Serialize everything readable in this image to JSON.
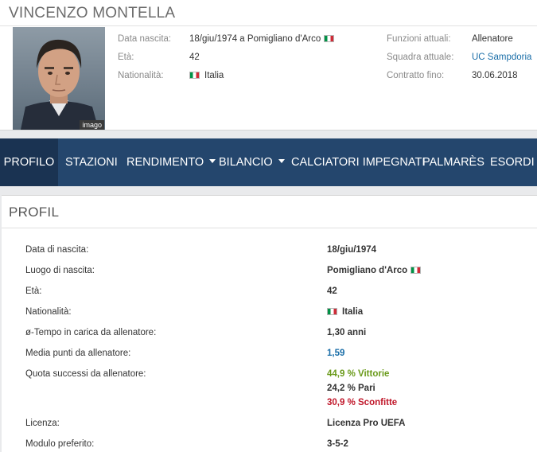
{
  "header": {
    "name": "VINCENZO MONTELLA",
    "photo_credit": "imago",
    "left_col": [
      {
        "label": "Data nascita:",
        "value": "18/giu/1974 a Pomigliano d'Arco",
        "flag": "italy-flag"
      },
      {
        "label": "Età:",
        "value": "42"
      },
      {
        "label": "Nationalità:",
        "value": "Italia",
        "flag": "italy-flag"
      }
    ],
    "right_col": [
      {
        "label": "Funzioni attuali:",
        "value": "Allenatore"
      },
      {
        "label": "Squadra attuale:",
        "value": "UC Sampdoria",
        "link": true
      },
      {
        "label": "Contratto fino:",
        "value": "30.06.2018"
      }
    ]
  },
  "nav": {
    "items": [
      {
        "label": "Profilo",
        "active": true
      },
      {
        "label": "Stazioni"
      },
      {
        "label": "Rendimento",
        "dropdown": true
      },
      {
        "label": "Bilancio",
        "dropdown": true
      },
      {
        "label": "Calciatori impegnati"
      },
      {
        "label": "Palmarès"
      },
      {
        "label": "Esordi"
      }
    ]
  },
  "profile": {
    "title": "PROFIL",
    "rows": [
      {
        "label": "Data di nascita:",
        "value": "18/giu/1974"
      },
      {
        "label": "Luogo di nascita:",
        "value": "Pomigliano d'Arco",
        "flag": "italy-flag"
      },
      {
        "label": "Età:",
        "value": "42"
      },
      {
        "label": "Nationalità:",
        "value": "Italia",
        "flag": "italy-flag"
      },
      {
        "label": "ø-Tempo in carica da allenatore:",
        "value": "1,30 anni"
      },
      {
        "label": "Media punti da allenatore:",
        "value": "1,59"
      },
      {
        "label": "Quota successi da allenatore:",
        "values": [
          "44,9 % Vittorie",
          "24,2 % Pari",
          "30,9 % Sconfitte"
        ]
      },
      {
        "label": "Licenza:",
        "value": "Licenza Pro UEFA"
      },
      {
        "label": "Modulo preferito:",
        "value": "3-5-2"
      }
    ]
  },
  "colors": {
    "nav_bg": "#24466d",
    "nav_active_bg": "#1a3352",
    "link": "#1a6ea8",
    "wins": "#6a9a1a",
    "losses": "#c0172a"
  }
}
